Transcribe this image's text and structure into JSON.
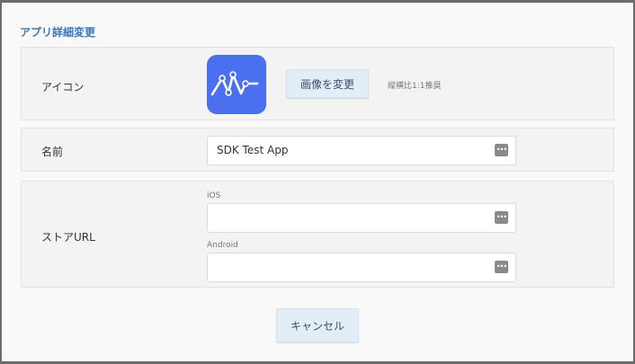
{
  "dialog": {
    "title": "アプリ詳細変更",
    "icon_row": {
      "label": "アイコン",
      "change_button": "画像を変更",
      "hint": "縦横比1:1推奨",
      "icon_color": "#4a70ef"
    },
    "name_row": {
      "label": "名前",
      "value": "SDK Test App",
      "field_icon": "password-key-icon"
    },
    "store_row": {
      "label": "ストアURL",
      "ios_label": "iOS",
      "ios_value": "",
      "android_label": "Android",
      "android_value": ""
    },
    "cancel_button": "キャンセル"
  }
}
